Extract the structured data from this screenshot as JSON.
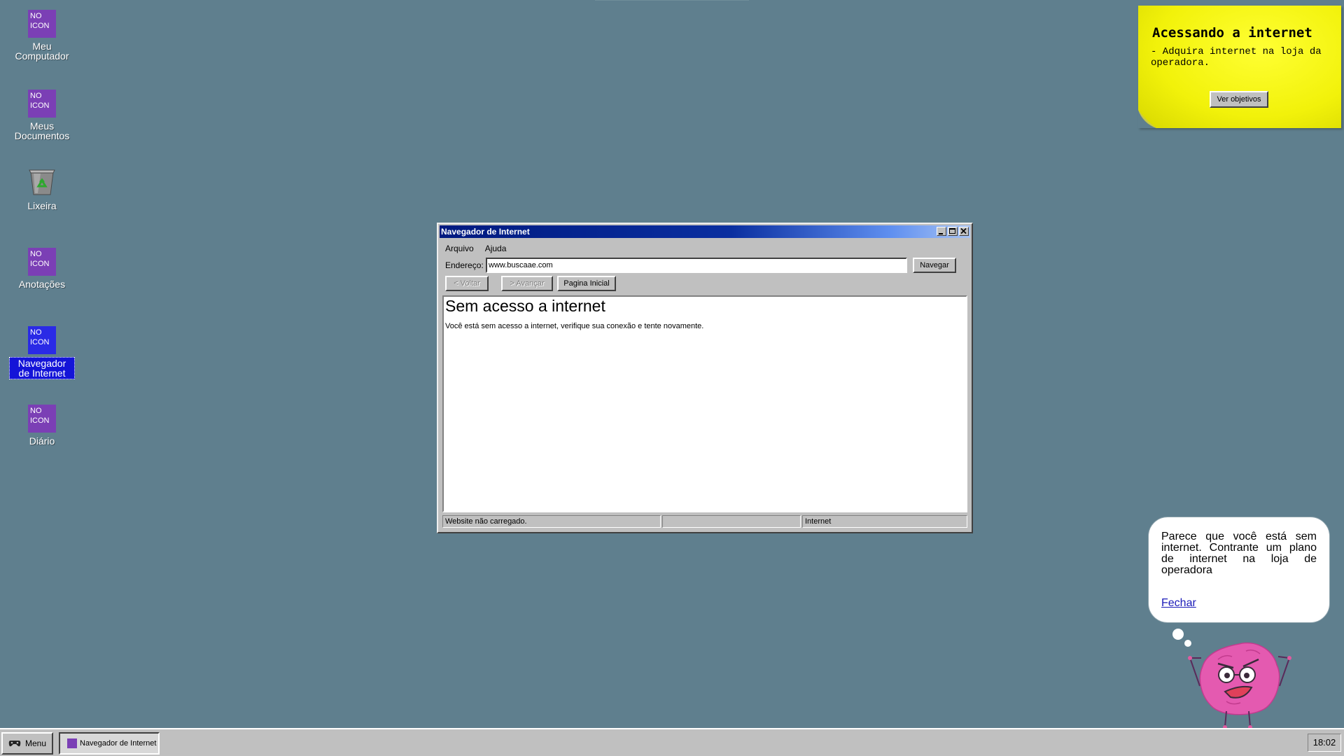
{
  "desktop": {
    "icons": [
      {
        "label": "Meu Computador",
        "icon_text": "NO ICON",
        "icon": "no-icon"
      },
      {
        "label": "Meus Documentos",
        "icon_text": "NO ICON",
        "icon": "no-icon"
      },
      {
        "label": "Lixeira",
        "icon": "recycle-bin-icon"
      },
      {
        "label": "Anotações",
        "icon_text": "NO ICON",
        "icon": "no-icon"
      },
      {
        "label": "Navegador de Internet",
        "icon_text": "NO ICON",
        "icon": "no-icon",
        "selected": true
      },
      {
        "label": "Diário",
        "icon_text": "NO ICON",
        "icon": "no-icon"
      }
    ]
  },
  "browser": {
    "title": "Navegador de Internet",
    "menu": [
      "Arquivo",
      "Ajuda"
    ],
    "address_label": "Endereço:",
    "address_value": "www.buscaae.com",
    "navigate_label": "Navegar",
    "back_label": "< Voltar",
    "forward_label": "> Avançar",
    "home_label": "Pagina Inicial",
    "page_heading": "Sem acesso a internet",
    "page_text": "Você está sem acesso a internet, verifique sua conexão e tente novamente.",
    "status": [
      "Website não carregado.",
      "",
      "Internet"
    ]
  },
  "sticky_note": {
    "title": "Acessando a internet",
    "text": "- Adquira internet na loja da operadora.",
    "button_label": "Ver objetivos"
  },
  "assistant": {
    "message": "Parece que você está sem internet. Contrante um plano de internet na loja de operadora",
    "close_label": "Fechar"
  },
  "taskbar": {
    "start_label": "Menu",
    "tasks": [
      "Navegador de Internet"
    ],
    "clock": "18:02"
  },
  "colors": {
    "desktop": "#5f7f8e",
    "titlebar": "#0a2fa0",
    "sticky": "#f2f20a",
    "no_icon": "#7b3fb5",
    "selection": "#1414d8"
  }
}
